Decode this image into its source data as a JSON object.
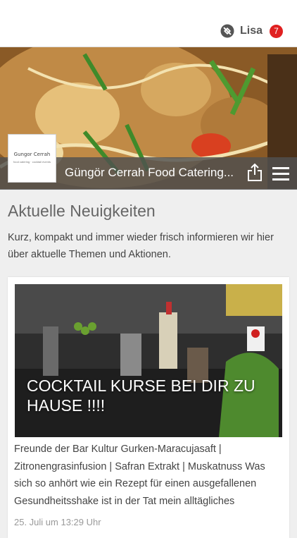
{
  "header": {
    "user_name": "Lisa",
    "notification_count": "7"
  },
  "hero": {
    "title": "Güngör Cerrah Food Catering...",
    "logo_name": "Gungor Cerrah",
    "logo_sub": "food catering · cocktail events"
  },
  "news": {
    "section_title": "Aktuelle Neuigkeiten",
    "intro": "Kurz, kompakt und immer wieder frisch informieren wir hier über aktuelle Themen und Aktionen.",
    "card": {
      "headline": "COCKTAIL KURSE BEI DIR ZU HAUSE !!!!",
      "text": "Freunde der Bar Kultur Gurken-Maracujasaft | Zitronengrasinfusion | Safran Extrakt | Muskatnuss Was sich so anhört wie ein Rezept für einen ausgefallenen Gesundheitsshake ist in der Tat mein alltägliches",
      "date": "25. Juli um 13:29 Uhr"
    }
  },
  "colors": {
    "badge": "#e02020",
    "titlebar": "#505050"
  }
}
